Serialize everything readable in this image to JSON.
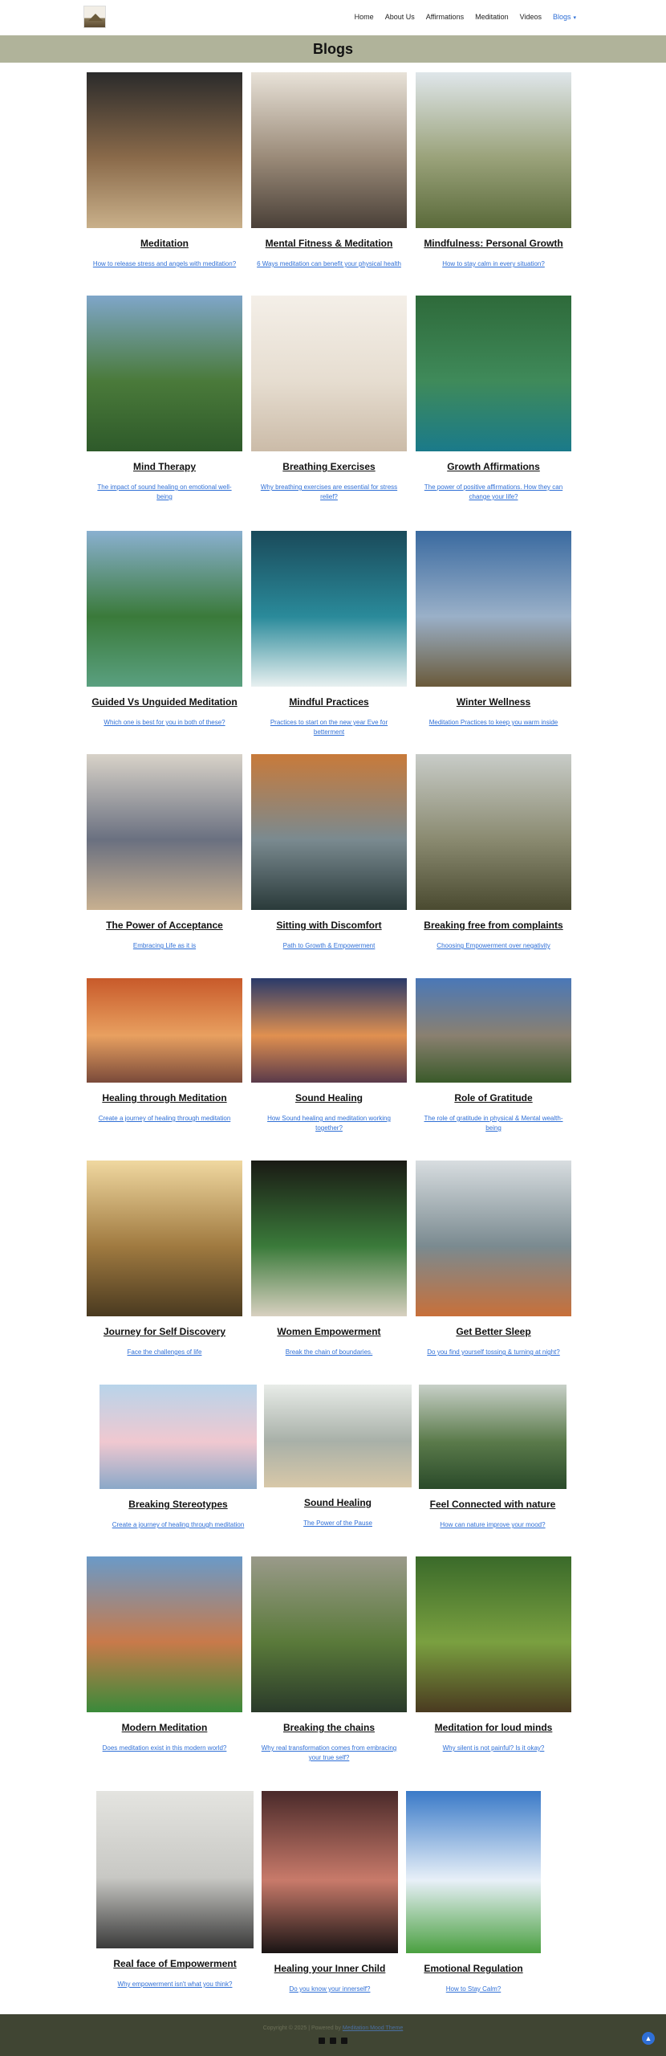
{
  "nav": {
    "items": [
      "Home",
      "About Us",
      "Affirmations",
      "Meditation",
      "Videos",
      "Blogs"
    ],
    "active": "Blogs"
  },
  "page_title": "Blogs",
  "blogs": [
    {
      "title": "Meditation",
      "subtitle": "How to release stress and angels with meditation?",
      "colors": [
        "#2b2b2b",
        "#8a6a4a",
        "#c9b08a"
      ]
    },
    {
      "title": "Mental Fitness & Meditation",
      "subtitle": "6 Ways meditation can benefit your physical health",
      "colors": [
        "#e8e2d8",
        "#9a8a78",
        "#4a4038"
      ]
    },
    {
      "title": "Mindfulness: Personal Growth",
      "subtitle": "How to stay calm in every situation?",
      "colors": [
        "#dfe6ea",
        "#9aa27a",
        "#5a6a3a"
      ]
    },
    {
      "title": "Mind Therapy",
      "subtitle": "The impact of sound healing on emotional well-being",
      "colors": [
        "#7fa6c9",
        "#4a7a3a",
        "#2e5a2a"
      ]
    },
    {
      "title": "Breathing Exercises",
      "subtitle": "Why breathing exercises are essential for stress relief?",
      "colors": [
        "#f4efe8",
        "#e6ddd0",
        "#cbbba8"
      ]
    },
    {
      "title": "Growth Affirmations",
      "subtitle": "The power of positive affirmations. How they can change your life?",
      "colors": [
        "#2e6a3a",
        "#3f8a5a",
        "#1a7a8a"
      ]
    },
    {
      "title": "Guided Vs Unguided Meditation",
      "subtitle": "Which one is best for you in both of these?",
      "colors": [
        "#8ab0d0",
        "#3a7a3a",
        "#5aa080"
      ]
    },
    {
      "title": "Mindful Practices",
      "subtitle": "Practices to start on the new year Eve for betterment",
      "colors": [
        "#1a4a5a",
        "#2a8a9a",
        "#e8f0f0"
      ]
    },
    {
      "title": "Winter Wellness",
      "subtitle": "Meditation Practices to keep you warm inside",
      "colors": [
        "#3a6aa0",
        "#9ab0c8",
        "#6a5a3a"
      ]
    },
    {
      "title": "The Power of Acceptance",
      "subtitle": "Embracing Life as it is",
      "colors": [
        "#d8d2c8",
        "#6a7080",
        "#c8b090"
      ]
    },
    {
      "title": "Sitting with Discomfort",
      "subtitle": "Path to Growth & Empowerment",
      "colors": [
        "#c87a3a",
        "#7a8a90",
        "#2a3a3a"
      ]
    },
    {
      "title": "Breaking free from complaints",
      "subtitle": "Choosing Empowerment over negativity",
      "colors": [
        "#c8ccc8",
        "#8a8a70",
        "#4a4a30"
      ]
    },
    {
      "title": "Healing through Meditation",
      "subtitle": "Create a journey of healing through meditation",
      "colors": [
        "#c85a2a",
        "#e8a060",
        "#7a4a3a"
      ]
    },
    {
      "title": "Sound Healing",
      "subtitle": "How Sound healing and meditation working together?",
      "colors": [
        "#2a3a6a",
        "#e09050",
        "#5a3a4a"
      ]
    },
    {
      "title": "Role of Gratitude",
      "subtitle": "The role of gratitude in physical & Mental wealth-being",
      "colors": [
        "#4a78b8",
        "#8a8070",
        "#3a5a2a"
      ]
    },
    {
      "title": "Journey for Self Discovery",
      "subtitle": "Face the challenges of life",
      "colors": [
        "#f0d8a0",
        "#a07a40",
        "#4a3a20"
      ]
    },
    {
      "title": "Women Empowerment",
      "subtitle": "Break the chain of boundaries.",
      "colors": [
        "#1a1a14",
        "#3a7a3a",
        "#d8d0c0"
      ]
    },
    {
      "title": "Get Better Sleep",
      "subtitle": "Do you find yourself tossing & turning at night?",
      "colors": [
        "#d8dde0",
        "#7a8a90",
        "#c8703a"
      ]
    },
    {
      "title": "Breaking Stereotypes",
      "subtitle": "Create a journey of healing through meditation",
      "colors": [
        "#b8d4ea",
        "#f0c8d0",
        "#8aa8c8"
      ]
    },
    {
      "title": "Sound Healing",
      "subtitle": "The Power of the Pause",
      "colors": [
        "#e8ece8",
        "#a8b0a8",
        "#d8c8a8"
      ]
    },
    {
      "title": "Feel Connected with nature",
      "subtitle": "How can nature improve your mood?",
      "colors": [
        "#c8d0c8",
        "#5a7a4a",
        "#2a4a2a"
      ]
    },
    {
      "title": "Modern Meditation",
      "subtitle": "Does meditation exist in this modern world?",
      "colors": [
        "#6a9ac8",
        "#c87a4a",
        "#3a8a3a"
      ]
    },
    {
      "title": "Breaking the chains",
      "subtitle": "Why real transformation comes from embracing your true self?",
      "colors": [
        "#9a9a8a",
        "#5a7a3a",
        "#2a3a2a"
      ]
    },
    {
      "title": "Meditation for loud minds",
      "subtitle": "Why silent is not painful? Is it okay?",
      "colors": [
        "#3a6a2a",
        "#7aa040",
        "#4a3a20"
      ]
    },
    {
      "title": "Real face of Empowerment",
      "subtitle": "Why empowerment isn't what you think?",
      "colors": [
        "#e4e4e0",
        "#c8c8c4",
        "#3a3a3a"
      ]
    },
    {
      "title": "Healing your Inner Child",
      "subtitle": "Do you know your innerself?",
      "colors": [
        "#4a2a2a",
        "#c87a6a",
        "#1a1414"
      ]
    },
    {
      "title": "Emotional Regulation",
      "subtitle": "How to Stay Calm?",
      "colors": [
        "#3a7ac8",
        "#e8f0f8",
        "#4aa040"
      ]
    }
  ],
  "footer": {
    "copyright": "Copyright © 2025 | Powered by",
    "powered_link": "Meditation Mood Theme"
  },
  "scroll_top_icon": "arrow-up-icon"
}
